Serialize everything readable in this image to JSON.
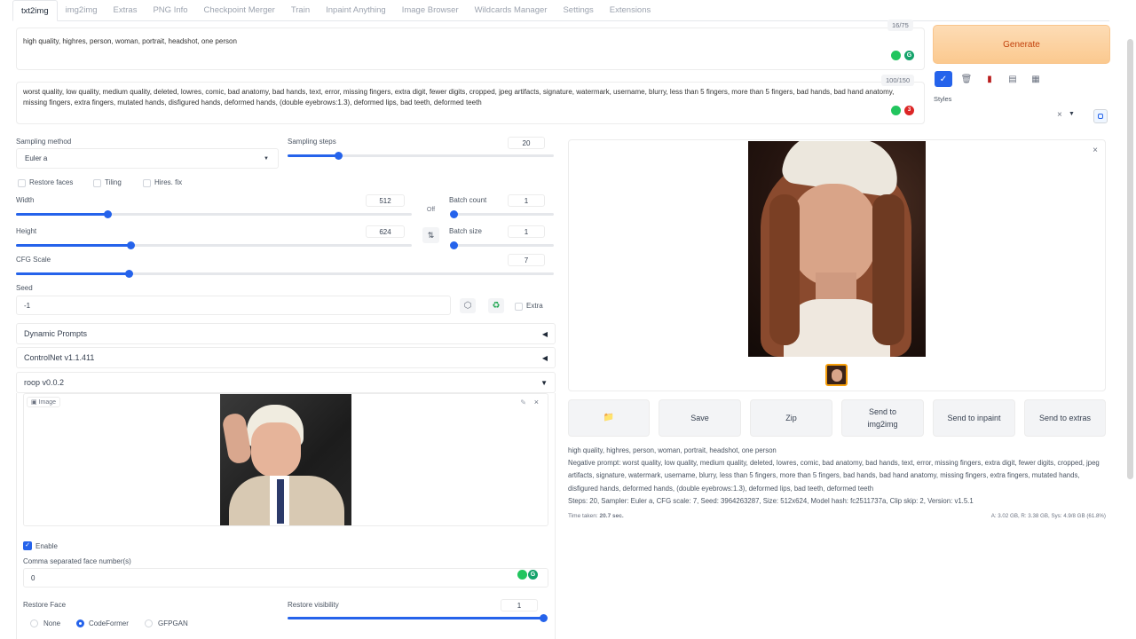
{
  "tabs": [
    "txt2img",
    "img2img",
    "Extras",
    "PNG Info",
    "Checkpoint Merger",
    "Train",
    "Inpaint Anything",
    "Image Browser",
    "Wildcards Manager",
    "Settings",
    "Extensions"
  ],
  "prompt": {
    "text": "high quality, highres, person, woman, portrait, headshot, one person",
    "counter": "16/75"
  },
  "negative_prompt": {
    "text": "worst quality, low quality, medium quality, deleted, lowres, comic, bad anatomy, bad hands, text, error, missing fingers, extra digit, fewer digits, cropped, jpeg artifacts, signature, watermark, username, blurry, less than 5 fingers, more than 5 fingers, bad hands, bad hand anatomy, missing fingers, extra fingers, mutated hands, disfigured hands, deformed hands, (double eyebrows:1.3), deformed lips, bad teeth, deformed teeth",
    "counter": "100/150"
  },
  "generate_label": "Generate",
  "styles_label": "Styles",
  "sampling": {
    "method_label": "Sampling method",
    "method_value": "Euler a",
    "steps_label": "Sampling steps",
    "steps_value": "20",
    "steps_fraction": 0.19
  },
  "options": {
    "restore_faces": "Restore faces",
    "tiling": "Tiling",
    "hires_fix": "Hires. fix"
  },
  "width": {
    "label": "Width",
    "value": "512",
    "fraction": 0.23
  },
  "height": {
    "label": "Height",
    "value": "624",
    "fraction": 0.29
  },
  "off_label": "Off",
  "batch_count": {
    "label": "Batch count",
    "value": "1",
    "fraction": 0.0
  },
  "batch_size": {
    "label": "Batch size",
    "value": "1",
    "fraction": 0.0
  },
  "cfg": {
    "label": "CFG Scale",
    "value": "7",
    "fraction": 0.21
  },
  "seed": {
    "label": "Seed",
    "value": "-1",
    "extra_label": "Extra"
  },
  "accordions": {
    "dynamic_prompts": "Dynamic Prompts",
    "controlnet": "ControlNet v1.1.411",
    "roop": "roop v0.0.2"
  },
  "roop": {
    "image_label": "Image",
    "enable_label": "Enable",
    "face_numbers_label": "Comma separated face number(s)",
    "face_numbers_value": "0",
    "restore_face_label": "Restore Face",
    "restore_options": [
      "None",
      "CodeFormer",
      "GFPGAN"
    ],
    "restore_selected": "CodeFormer",
    "restore_visibility_label": "Restore visibility",
    "restore_visibility_value": "1",
    "restore_visibility_fraction": 1.0
  },
  "output_buttons": {
    "save": "Save",
    "zip": "Zip",
    "send_img2img": "Send to img2img",
    "send_inpaint": "Send to inpaint",
    "send_extras": "Send to extras"
  },
  "info": {
    "prompt": "high quality, highres, person, woman, portrait, headshot, one person",
    "negative": "Negative prompt: worst quality, low quality, medium quality, deleted, lowres, comic, bad anatomy, bad hands, text, error, missing fingers, extra digit, fewer digits, cropped, jpeg artifacts, signature, watermark, username, blurry, less than 5 fingers, more than 5 fingers, bad hands, bad hand anatomy, missing fingers, extra fingers, mutated hands, disfigured hands, deformed hands, (double eyebrows:1.3), deformed lips, bad teeth, deformed teeth",
    "params": "Steps: 20, Sampler: Euler a, CFG scale: 7, Seed: 3964263287, Size: 512x624, Model hash: fc2511737a, Clip skip: 2, Version: v1.5.1",
    "time_label": "Time taken:",
    "time_value": "20.7 sec.",
    "memory": "A: 3.02 GB, R: 3.38 GB, Sys: 4.9/8 GB (61.8%)"
  },
  "colors": {
    "accent": "#2563eb",
    "generate_bg": "#fbc98f",
    "generate_text": "#c2410c"
  }
}
